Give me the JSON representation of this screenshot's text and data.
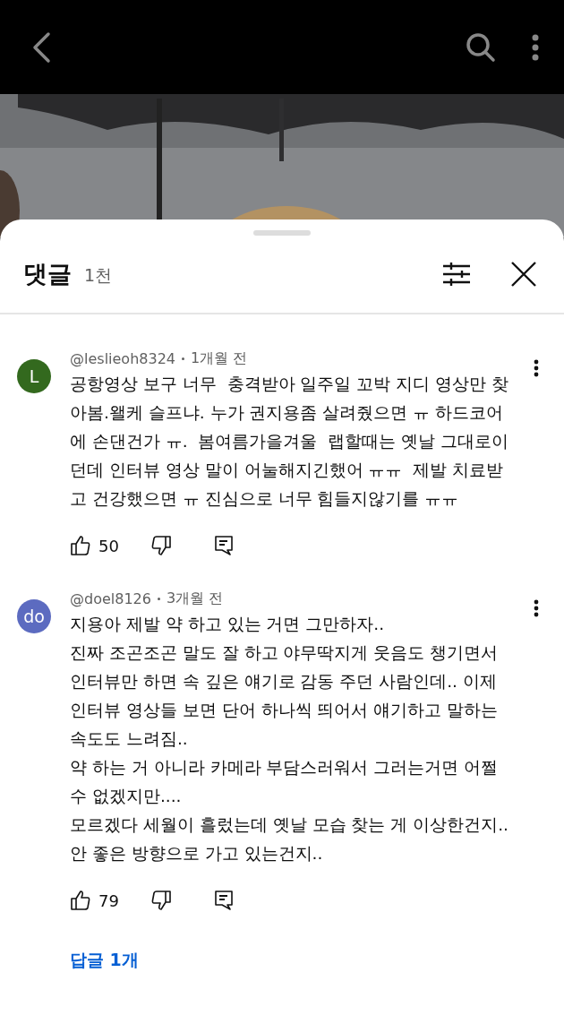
{
  "sheet": {
    "title": "댓글",
    "count": "1천"
  },
  "comments": [
    {
      "avatar": "L",
      "color": "#33691e",
      "author": "@leslieoh8324",
      "time": "1개월 전",
      "text": "공항영상 보구 너무  충격받아 일주일 꼬박 지디 영상만 찾아봄.왤케 슬프냐. 누가 권지용좀 살려줬으면 ㅠ 하드코어에 손댄건가 ㅠ.  봄여름가을겨울  랩할때는 옛날 그대로이던데 인터뷰 영상 말이 어눌해지긴했어 ㅠㅠ  제발 치료받고 건강했으면 ㅠ 진심으로 너무 힘들지않기를 ㅠㅠ",
      "likes": "50"
    },
    {
      "avatar": "do",
      "color": "#5c6bc0",
      "author": "@doel8126",
      "time": "3개월 전",
      "text": "지용아 제발 약 하고 있는 거면 그만하자..\n진짜 조곤조곤 말도 잘 하고 야무딱지게 웃음도 챙기면서 인터뷰만 하면 속 깊은 얘기로 감동 주던 사람인데.. 이제 인터뷰 영상들 보면 단어 하나씩 띄어서 얘기하고 말하는 속도도 느려짐..\n약 하는 거 아니라 카메라 부담스러워서 그러는거면 어쩔 수 없겠지만....\n모르겠다 세월이 흘렀는데 옛날 모습 찾는 게 이상한건지..\n안 좋은 방향으로 가고 있는건지..",
      "likes": "79",
      "replies": "답글 1개"
    }
  ]
}
